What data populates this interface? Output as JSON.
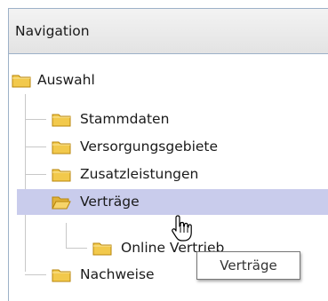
{
  "panel": {
    "title": "Navigation"
  },
  "tree": {
    "root": {
      "label": "Auswahl"
    },
    "children": [
      {
        "label": "Stammdaten"
      },
      {
        "label": "Versorgungsgebiete"
      },
      {
        "label": "Zusatzleistungen"
      },
      {
        "label": "Verträge",
        "selected": true
      },
      {
        "label": "Online Vertrieb",
        "partially_hidden": true
      },
      {
        "label": "Nachweise"
      }
    ]
  },
  "tooltip": {
    "text": "Verträge"
  },
  "colors": {
    "selection": "#c9ccec",
    "folder": "#f2c94c",
    "border": "#9db1c8"
  }
}
